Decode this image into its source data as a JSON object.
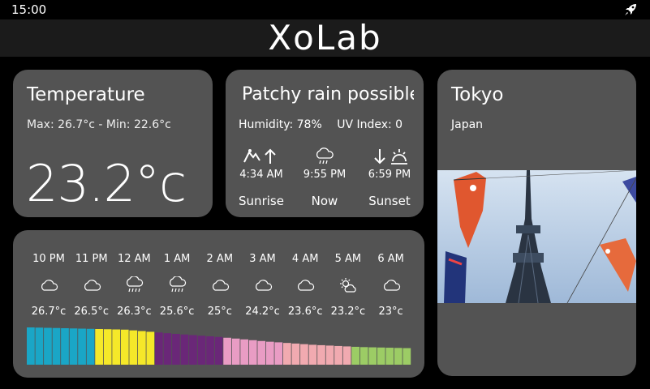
{
  "status": {
    "time": "15:00"
  },
  "header": {
    "title": "XoLab"
  },
  "temperature": {
    "title": "Temperature",
    "minmax": "Max: 26.7°c  -  Min: 22.6°c",
    "current": "23.2°c"
  },
  "condition": {
    "title": "Patchy rain possible",
    "humidity": "Humidity: 78%",
    "uv": "UV Index: 0",
    "sunrise_time": "4:34 AM",
    "now_time": "9:55 PM",
    "sunset_time": "6:59 PM",
    "sunrise_label": "Sunrise",
    "now_label": "Now",
    "sunset_label": "Sunset"
  },
  "city": {
    "name": "Tokyo",
    "country": "Japan"
  },
  "forecast": [
    {
      "hour": "10 PM",
      "icon": "cloud-icon",
      "temp": "26.7°c"
    },
    {
      "hour": "11 PM",
      "icon": "cloud-icon",
      "temp": "26.5°c"
    },
    {
      "hour": "12 AM",
      "icon": "rain-icon",
      "temp": "26.3°c"
    },
    {
      "hour": "1 AM",
      "icon": "rain-icon",
      "temp": "25.6°c"
    },
    {
      "hour": "2 AM",
      "icon": "cloud-icon",
      "temp": "25°c"
    },
    {
      "hour": "3 AM",
      "icon": "cloud-icon",
      "temp": "24.2°c"
    },
    {
      "hour": "4 AM",
      "icon": "cloud-icon",
      "temp": "23.6°c"
    },
    {
      "hour": "5 AM",
      "icon": "partly-cloudy-icon",
      "temp": "23.2°c"
    },
    {
      "hour": "6 AM",
      "icon": "cloud-icon",
      "temp": "23°c"
    }
  ],
  "bar_colors": [
    "#1aa6c6",
    "#f5e829",
    "#6a2778",
    "#e99cc4",
    "#f1aab0",
    "#9ccc65"
  ]
}
